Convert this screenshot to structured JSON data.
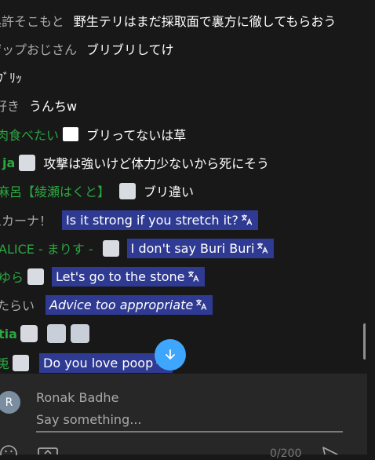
{
  "chat": {
    "messages": [
      {
        "author": "処許そこもと",
        "text": "野生テリはまだ採取面で裏方に徹してもらおう"
      },
      {
        "author": "ザップおじさん",
        "text": "ブリブリしてけ"
      },
      {
        "author": "",
        "text": "ﾌﾞﾘｯ"
      },
      {
        "author": "好き",
        "text": "うんちw"
      },
      {
        "author": "肉食べたい",
        "text": "ブリってないは草"
      },
      {
        "author": "ja",
        "text": "攻撃は強いけど体力少ないから死にそう"
      },
      {
        "author": "麻呂【綾瀬はくと】",
        "text": "ブリ違い"
      },
      {
        "author": "ムカーナ！",
        "text": "Is it strong if you stretch it?"
      },
      {
        "author": "ALICE - まりす -",
        "text": "I don't say Buri Buri"
      },
      {
        "author": "ゆら",
        "text": "Let's go to the stone"
      },
      {
        "author": "たらい",
        "text": "Advice too appropriate"
      },
      {
        "author": "tia",
        "text": ""
      },
      {
        "author": "兎",
        "text": "Do you love poop"
      }
    ]
  },
  "composer": {
    "avatar_letter": "R",
    "user_name": "Ronak Badhe",
    "placeholder": "Say something...",
    "counter": "0/200"
  },
  "colors": {
    "translation_bg": "#2f3a92",
    "member_green": "#2ba640",
    "accent_blue": "#3ea6ff"
  }
}
